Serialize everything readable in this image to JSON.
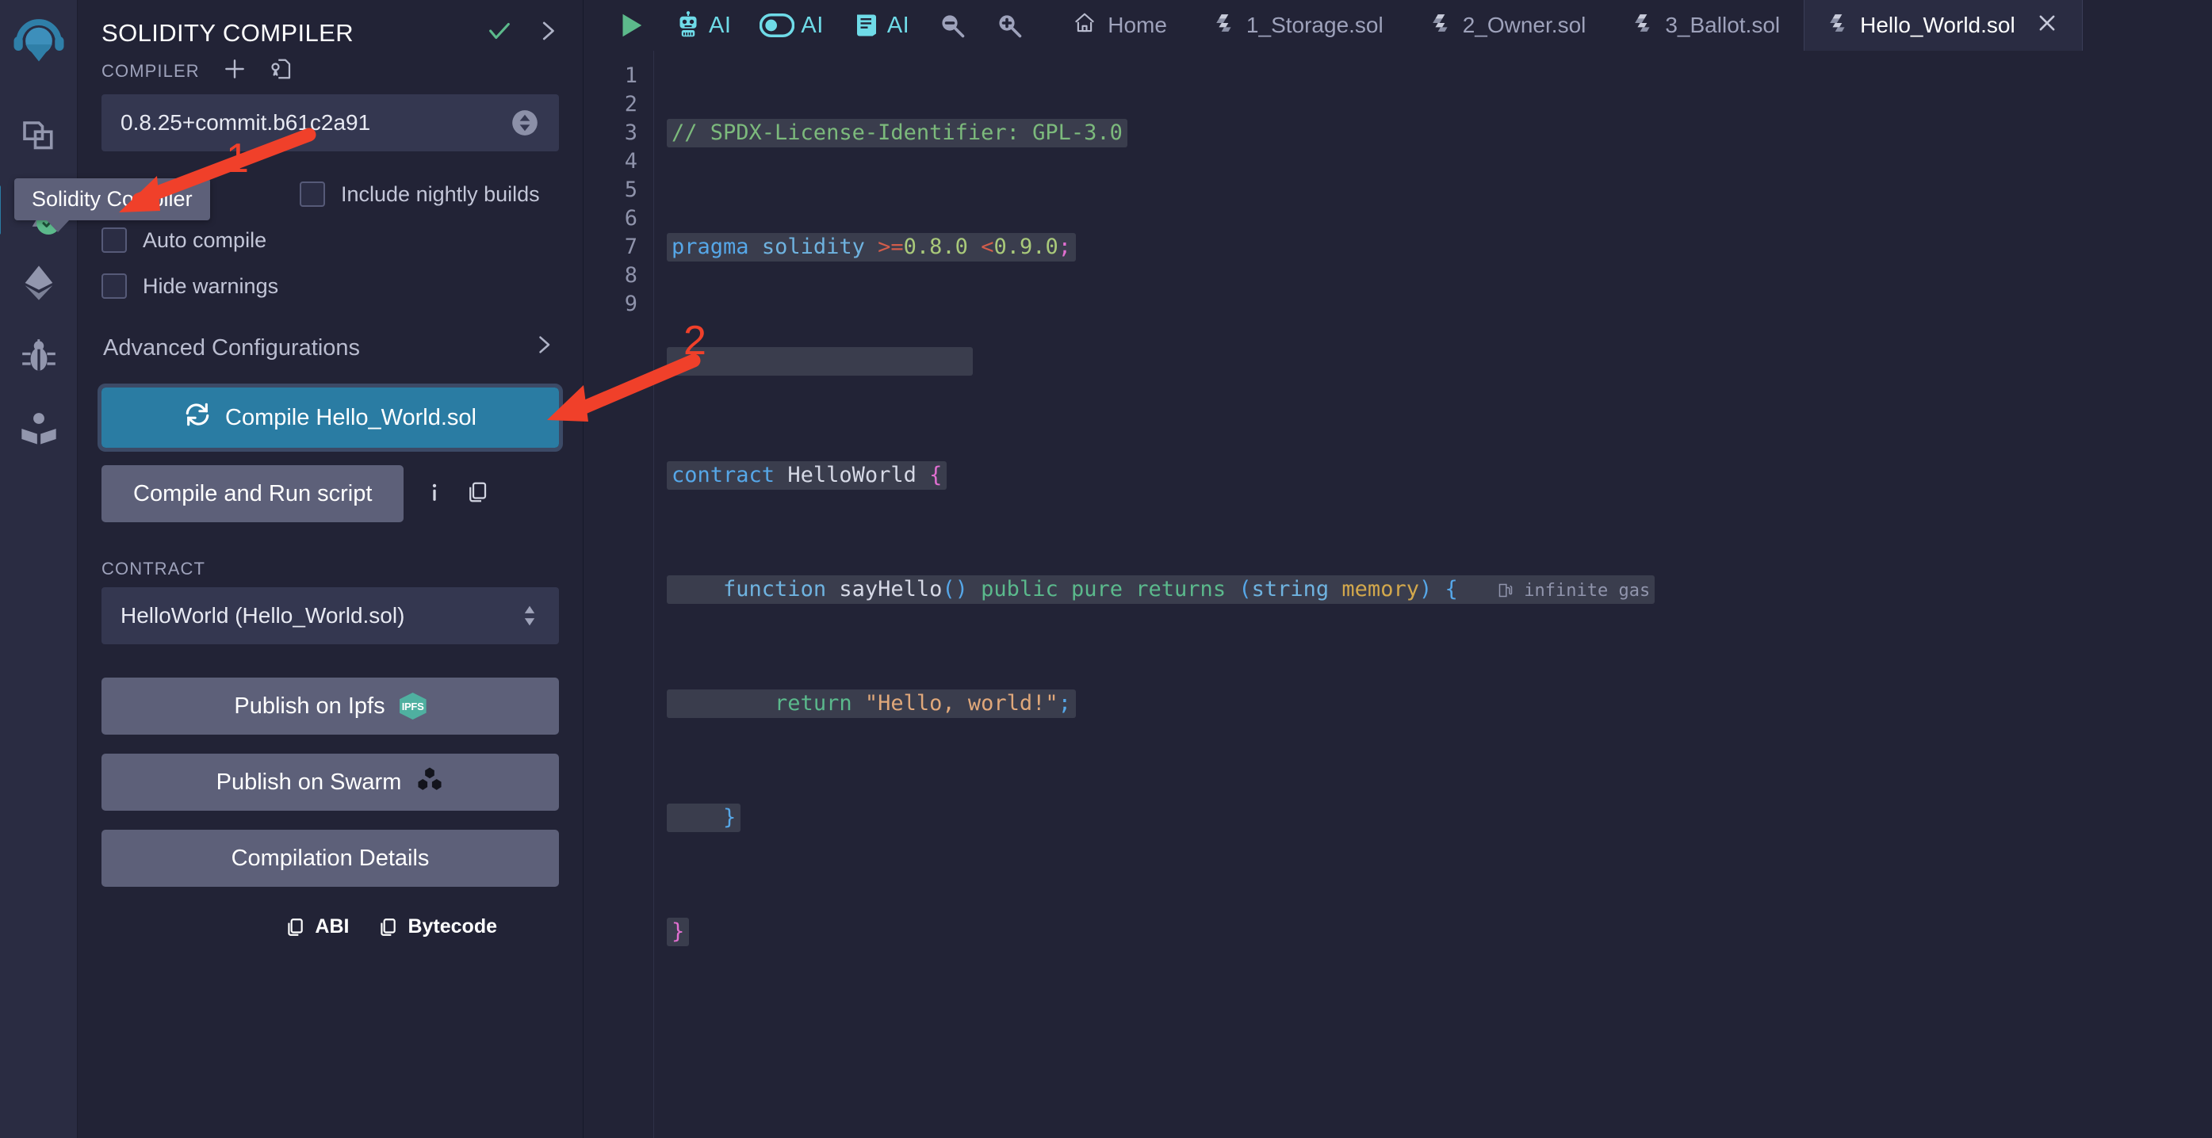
{
  "rail": {
    "items": [
      {
        "name": "remix-logo",
        "label": "Remix"
      },
      {
        "name": "file-explorer",
        "label": "File explorer"
      },
      {
        "name": "solidity-compiler",
        "label": "Solidity Compiler"
      },
      {
        "name": "deploy-run",
        "label": "Deploy & run transactions"
      },
      {
        "name": "debugger",
        "label": "Debugger"
      },
      {
        "name": "learneth",
        "label": "LearnEth"
      }
    ]
  },
  "tooltip": {
    "text": "Solidity Compiler"
  },
  "panel": {
    "title": "SOLIDITY COMPILER",
    "head_icons": [
      "check-icon",
      "chevron-right-icon"
    ],
    "compiler_section_label": "COMPILER",
    "compiler_icons": [
      "plus-icon",
      "add-custom-compiler-icon"
    ],
    "compiler_version": "0.8.25+commit.b61c2a91",
    "checkboxes": [
      {
        "label": "Include nightly builds",
        "checked": false
      },
      {
        "label": "Auto compile",
        "checked": false
      },
      {
        "label": "Hide warnings",
        "checked": false
      }
    ],
    "advanced_configurations": "Advanced Configurations",
    "compile_button": "Compile Hello_World.sol",
    "compile_and_run": "Compile and Run script",
    "run_icons": [
      "info-icon",
      "copy-icon"
    ],
    "contract_section_label": "CONTRACT",
    "contract_value": "HelloWorld (Hello_World.sol)",
    "publish_ipfs": "Publish on Ipfs",
    "ipfs_badge": "IPFS",
    "publish_swarm": "Publish on Swarm",
    "compilation_details": "Compilation Details",
    "abi": "ABI",
    "bytecode": "Bytecode"
  },
  "toolbar": {
    "items": [
      {
        "name": "run-script-button",
        "icon": "play-icon",
        "label": ""
      },
      {
        "name": "ai-assistant-button",
        "icon": "robot-icon",
        "label": "AI"
      },
      {
        "name": "ai-toggle-button",
        "icon": "toggle-icon",
        "label": "AI"
      },
      {
        "name": "ai-docs-button",
        "icon": "book-icon",
        "label": "AI"
      },
      {
        "name": "zoom-out-button",
        "icon": "zoom-out-icon",
        "label": ""
      },
      {
        "name": "zoom-in-button",
        "icon": "zoom-in-icon",
        "label": ""
      }
    ]
  },
  "tabs": [
    {
      "label": "Home",
      "icon": "home-icon",
      "active": false,
      "closable": false
    },
    {
      "label": "1_Storage.sol",
      "icon": "solidity-icon",
      "active": false,
      "closable": false
    },
    {
      "label": "2_Owner.sol",
      "icon": "solidity-icon",
      "active": false,
      "closable": false
    },
    {
      "label": "3_Ballot.sol",
      "icon": "solidity-icon",
      "active": false,
      "closable": false
    },
    {
      "label": "Hello_World.sol",
      "icon": "solidity-icon",
      "active": true,
      "closable": true
    }
  ],
  "editor": {
    "line_numbers": [
      "1",
      "2",
      "3",
      "4",
      "5",
      "6",
      "7",
      "8",
      "9"
    ],
    "gas_annotation": "infinite gas",
    "code": {
      "l1_comment": "// SPDX-License-Identifier: GPL-3.0",
      "l2_pragma": "pragma",
      "l2_solidity": "solidity",
      "l2_gte": ">=",
      "l2_v1": "0.8.0",
      "l2_lt": "<",
      "l2_v2": "0.9.0",
      "l2_semi": ";",
      "l4_contract": "contract",
      "l4_name": "HelloWorld",
      "l4_brace": "{",
      "l5_function": "function",
      "l5_name": "sayHello",
      "l5_parens": "()",
      "l5_public": "public",
      "l5_pure": "pure",
      "l5_returns": "returns",
      "l5_open": "(",
      "l5_string": "string",
      "l5_memory": "memory",
      "l5_close": ")",
      "l5_brace": "{",
      "l6_return": "return",
      "l6_str": "\"Hello, world!\"",
      "l6_semi": ";",
      "l7_brace": "}",
      "l8_brace": "}"
    }
  },
  "annotations": [
    {
      "number": "1",
      "points_to": "compiler-version-select"
    },
    {
      "number": "2",
      "points_to": "compile-button"
    }
  ],
  "colors": {
    "accent_blue": "#2a7ca3",
    "panel_bg": "#222336",
    "rail_bg": "#2a2c42",
    "grey_button": "#5d6079",
    "annotation_red": "#f0402a",
    "check_green": "#5cb98b",
    "ai_cyan": "#6fdbe8"
  }
}
